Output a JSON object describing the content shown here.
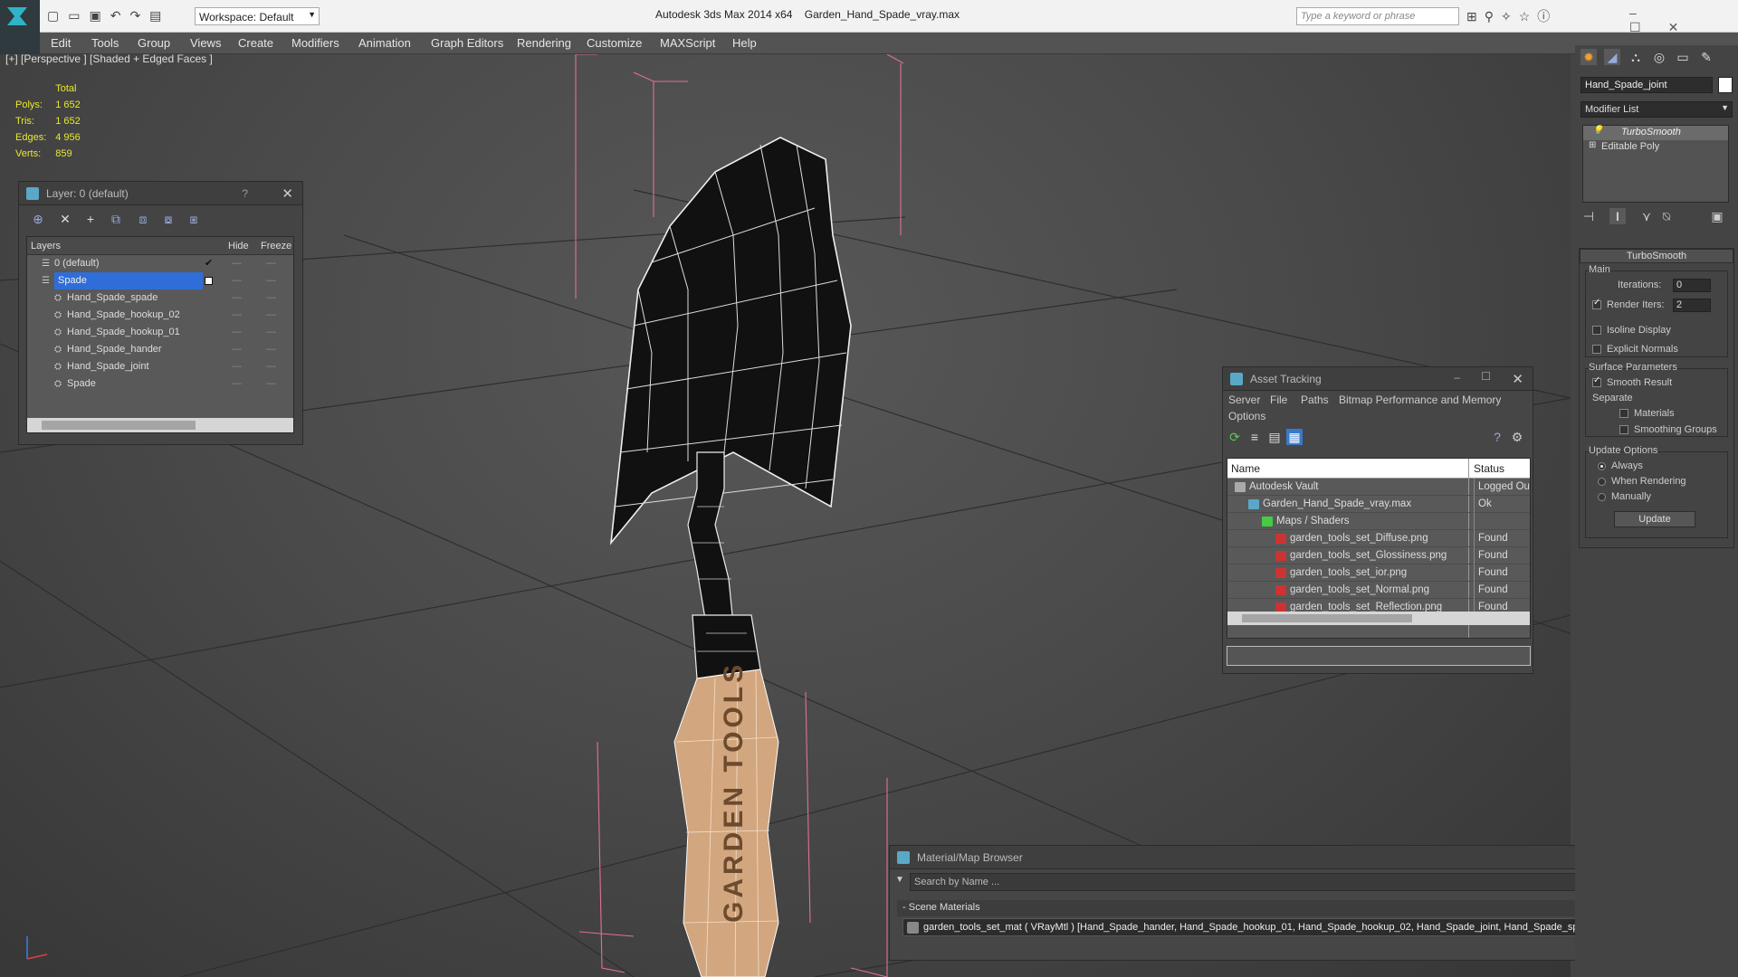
{
  "titlebar": {
    "workspace_label": "Workspace: Default",
    "app_title": "Autodesk 3ds Max  2014 x64",
    "file_title": "Garden_Hand_Spade_vray.max",
    "search_placeholder": "Type a keyword or phrase"
  },
  "menu": [
    "Edit",
    "Tools",
    "Group",
    "Views",
    "Create",
    "Modifiers",
    "Animation",
    "Graph Editors",
    "Rendering",
    "Customize",
    "MAXScript",
    "Help"
  ],
  "viewport": {
    "label": "[+] [Perspective ] [Shaded + Edged Faces ]",
    "stats": {
      "header": "Total",
      "rows": [
        {
          "k": "Polys:",
          "v": "1 652"
        },
        {
          "k": "Tris:",
          "v": "1 652"
        },
        {
          "k": "Edges:",
          "v": "4 956"
        },
        {
          "k": "Verts:",
          "v": "859"
        }
      ]
    },
    "handle_text": "GARDEN TOOLS"
  },
  "layer_panel": {
    "title": "Layer: 0 (default)",
    "help": "?",
    "columns": [
      "Layers",
      "Hide",
      "Freeze"
    ],
    "rows": [
      {
        "name": "0 (default)",
        "level": 0
      },
      {
        "name": "Spade",
        "level": 0,
        "selected": true
      },
      {
        "name": "Hand_Spade_spade",
        "level": 1
      },
      {
        "name": "Hand_Spade_hookup_02",
        "level": 1
      },
      {
        "name": "Hand_Spade_hookup_01",
        "level": 1
      },
      {
        "name": "Hand_Spade_hander",
        "level": 1
      },
      {
        "name": "Hand_Spade_joint",
        "level": 1
      },
      {
        "name": "Spade",
        "level": 1
      }
    ]
  },
  "asset_panel": {
    "title": "Asset Tracking",
    "menu": [
      "Server",
      "File",
      "Paths",
      "Bitmap Performance and Memory",
      "Options"
    ],
    "columns": [
      "Name",
      "Status"
    ],
    "rows": [
      {
        "name": "Autodesk Vault",
        "status": "Logged Ou",
        "level": 0
      },
      {
        "name": "Garden_Hand_Spade_vray.max",
        "status": "Ok",
        "level": 1
      },
      {
        "name": "Maps / Shaders",
        "status": "",
        "level": 2
      },
      {
        "name": "garden_tools_set_Diffuse.png",
        "status": "Found",
        "level": 3
      },
      {
        "name": "garden_tools_set_Glossiness.png",
        "status": "Found",
        "level": 3
      },
      {
        "name": "garden_tools_set_ior.png",
        "status": "Found",
        "level": 3
      },
      {
        "name": "garden_tools_set_Normal.png",
        "status": "Found",
        "level": 3
      },
      {
        "name": "garden_tools_set_Reflection.png",
        "status": "Found",
        "level": 3
      }
    ]
  },
  "material_panel": {
    "title": "Material/Map Browser",
    "search_placeholder": "Search by Name ...",
    "section": "Scene Materials",
    "item": "garden_tools_set_mat ( VRayMtl ) [Hand_Spade_hander, Hand_Spade_hookup_01, Hand_Spade_hookup_02, Hand_Spade_joint, Hand_Spade_spade]"
  },
  "command_panel": {
    "object_name": "Hand_Spade_joint",
    "modifier_list": "Modifier List",
    "stack": [
      "TurboSmooth",
      "Editable Poly"
    ],
    "rollout_title": "TurboSmooth",
    "main_label": "Main",
    "iterations_label": "Iterations:",
    "iterations_value": "0",
    "render_iters_label": "Render Iters:",
    "render_iters_value": "2",
    "isoline": "Isoline Display",
    "explicit": "Explicit Normals",
    "surface_params": "Surface Parameters",
    "smooth_result": "Smooth Result",
    "separate": "Separate",
    "materials": "Materials",
    "smoothing_groups": "Smoothing Groups",
    "update_options": "Update Options",
    "always": "Always",
    "when_rendering": "When Rendering",
    "manually": "Manually",
    "update_button": "Update"
  }
}
